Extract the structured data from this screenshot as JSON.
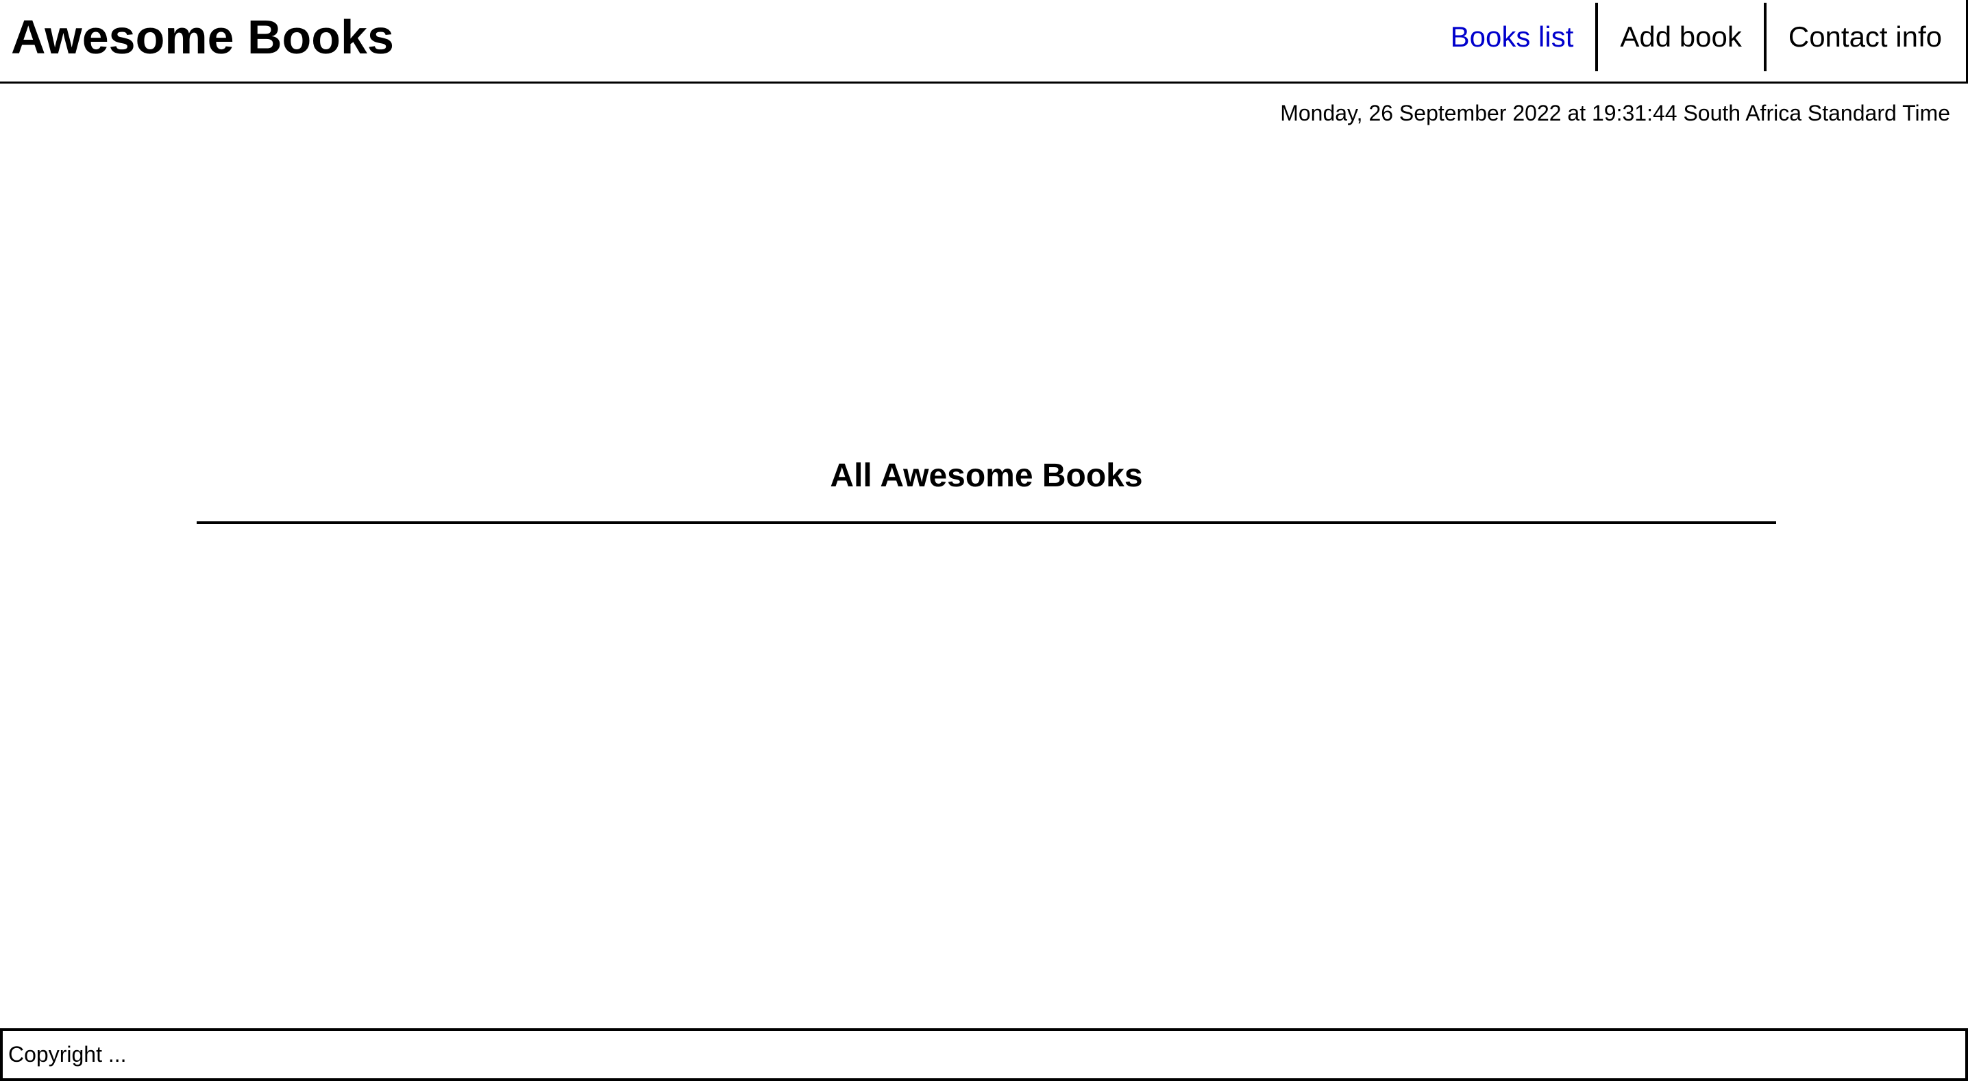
{
  "header": {
    "brand": "Awesome Books",
    "nav": [
      {
        "label": "Books list",
        "active": true
      },
      {
        "label": "Add book",
        "active": false
      },
      {
        "label": "Contact info",
        "active": false
      }
    ]
  },
  "datetime": "Monday, 26 September 2022 at 19:31:44 South Africa Standard Time",
  "books_section": {
    "title": "All Awesome Books"
  },
  "footer": {
    "text": "Copyright ..."
  },
  "colors": {
    "active_link": "#0000cc",
    "text": "#000000",
    "background": "#ffffff"
  }
}
